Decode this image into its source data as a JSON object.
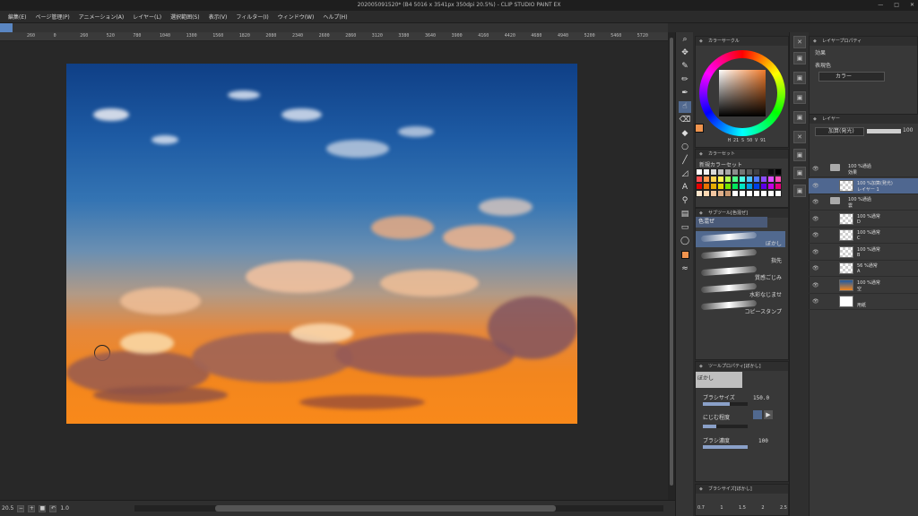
{
  "window": {
    "title": "202005091520* (B4 5016 x 3541px 350dpi 20.5%) - CLIP STUDIO PAINT EX",
    "controls": [
      "—",
      "□",
      "✕"
    ]
  },
  "menu": [
    "編集(E)",
    "ページ管理(P)",
    "アニメーション(A)",
    "レイヤー(L)",
    "選択範囲(S)",
    "表示(V)",
    "フィルター(I)",
    "ウィンドウ(W)",
    "ヘルプ(H)"
  ],
  "ruler": [
    "260",
    "0",
    "260",
    "520",
    "780",
    "1040",
    "1300",
    "1560",
    "1820",
    "2080",
    "2340",
    "2600",
    "2860",
    "3120",
    "3380",
    "3640",
    "3900",
    "4160",
    "4420",
    "4680",
    "4940",
    "5200",
    "5460",
    "5720"
  ],
  "status": {
    "zoom": "20.5",
    "angle": "1.0"
  },
  "color_panel": {
    "title": "カラーサークル",
    "hsv": "H 21 S 50 V 91",
    "current_color": "#f0944e"
  },
  "color_set": {
    "title": "カラーセット",
    "set_name": "新規カラーセット",
    "swatches": [
      "#ffffff",
      "#f2f2f2",
      "#d9d9d9",
      "#bfbfbf",
      "#a6a6a6",
      "#8c8c8c",
      "#737373",
      "#595959",
      "#404040",
      "#262626",
      "#0d0d0d",
      "#000000",
      "#ff4d4d",
      "#ff994d",
      "#ffd24d",
      "#fff24d",
      "#b3ff4d",
      "#4dff88",
      "#4dffe6",
      "#4dc3ff",
      "#4d7aff",
      "#8c4dff",
      "#e14dff",
      "#ff4db8",
      "#e60000",
      "#e67300",
      "#e6ac00",
      "#e6d800",
      "#73e600",
      "#00e65c",
      "#00e6c3",
      "#009ce6",
      "#0040e6",
      "#5c00e6",
      "#c300e6",
      "#e6007a",
      "#ffe6cc",
      "#ffd9b3",
      "#f2c6a0",
      "#e0b08a",
      "#c99870",
      "#ffffff",
      "#ffffff",
      "#ffffff",
      "#ffffff",
      "#ffffff",
      "#ffffff",
      "#ffffff"
    ]
  },
  "subtool": {
    "panel_title": "サブツール[色混ぜ]",
    "group_tab": "色混ぜ",
    "items": [
      "ぼかし",
      "指先",
      "質感ごじみ",
      "水彩なじませ",
      "コピースタンプ"
    ]
  },
  "tool_property": {
    "panel_title": "ツールプロパティ[ぼかし]",
    "preview_label": "ぼかし",
    "brush_size_label": "ブラシサイズ",
    "brush_size_value": "150.0",
    "brush_size_fraction": 0.6,
    "blur_label": "にじむ程度",
    "density_label": "ブラシ濃度",
    "density_value": "100",
    "density_fraction": 1.0
  },
  "brush_size_panel": {
    "title": "ブラシサイズ[ぼかし]",
    "sizes": [
      "0.7",
      "1",
      "1.5",
      "2",
      "2.5"
    ]
  },
  "effect_panel": {
    "title": "レイヤープロパティ",
    "effect_label": "効果",
    "expression_label": "表現色",
    "expression_value": "カラー"
  },
  "layer_panel": {
    "title": "レイヤー",
    "blend_mode": "加算(発光)",
    "opacity": "100",
    "layers": [
      {
        "t1": "100 %通過",
        "t2": "効果",
        "type": "folder",
        "sel": false
      },
      {
        "t1": "100 %加算(発光)",
        "t2": "レイヤー 1",
        "type": "layer",
        "sel": true
      },
      {
        "t1": "100 %通過",
        "t2": "雲",
        "type": "folder",
        "sel": false
      },
      {
        "t1": "100 %通常",
        "t2": "D",
        "type": "layer",
        "sel": false
      },
      {
        "t1": "100 %通常",
        "t2": "C",
        "type": "layer",
        "sel": false
      },
      {
        "t1": "100 %通常",
        "t2": "B",
        "type": "layer",
        "sel": false
      },
      {
        "t1": "56 %通常",
        "t2": "A",
        "type": "layer",
        "sel": false
      },
      {
        "t1": "100 %通常",
        "t2": "空",
        "type": "sky",
        "sel": false
      },
      {
        "t1": "",
        "t2": "用紙",
        "type": "paper",
        "sel": false
      }
    ]
  }
}
